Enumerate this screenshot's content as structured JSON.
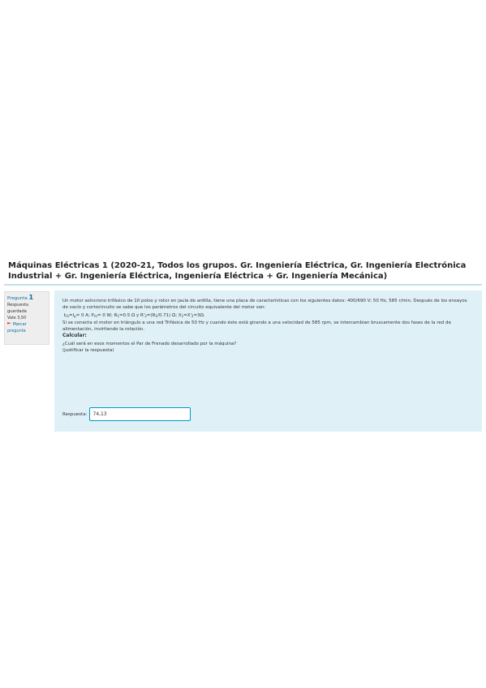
{
  "course": {
    "title": "Máquinas Eléctricas 1 (2020-21, Todos los grupos. Gr. Ingeniería Eléctrica, Gr. Ingeniería Electrónica Industrial + Gr. Ingeniería Eléctrica, Ingeniería Eléctrica + Gr. Ingeniería Mecánica)"
  },
  "question_info": {
    "label": "Pregunta",
    "number": "1",
    "state": "Respuesta guardada",
    "grade": "Vale 3,50",
    "flag_label": "Marcar pregunta"
  },
  "question": {
    "paragraph1": "Un motor asíncrono trifásico de 10 polos y rotor en jaula de ardilla, tiene una placa de características con los siguientes datos: 400/690 V; 50 Hz, 585 r/min. Después de los ensayos de vacío y cortocircuito se sabe que los parámetros del circuito equivalente del motor son:",
    "params": {
      "i_fe": "I",
      "i_fe_sub": "Fe",
      "eq1": "=I",
      "i_mu_sub": "μ",
      "v1": "= 0 A;  P",
      "pm_sub": "m",
      "v2": "= 0 W;  R",
      "r1_sub": "1",
      "v3": "=0.5 Ω y  R'",
      "r2_sub": "2",
      "v4": "=(R",
      "r1b_sub": "1",
      "v5": "/0.71) Ω; X",
      "x1_sub": "1",
      "v6": "=X'",
      "x2_sub": "2",
      "v7": "=3Ω."
    },
    "paragraph3": "Si se conecta el motor en triángulo a una red Trifásica de 50 Hz y cuando éste está girando a una velocidad de 585 rpm, se intercambian bruscamente dos fases de la red de alimentación, invirtiendo la rotación.",
    "calc_label": "Calcular:",
    "question_text": "¿Cuál será en esos momentos el Par de Frenado desarrollado por la máquina?",
    "justify_text": "(justificar la respuesta)",
    "answer_label": "Respuesta:",
    "answer_value": "74,13"
  },
  "colors": {
    "content_bg": "#dff0f6",
    "info_bg": "#eeeeee",
    "accent": "#0070a8",
    "input_border": "#0099c6"
  },
  "icons": {
    "flag": "flag-icon"
  }
}
